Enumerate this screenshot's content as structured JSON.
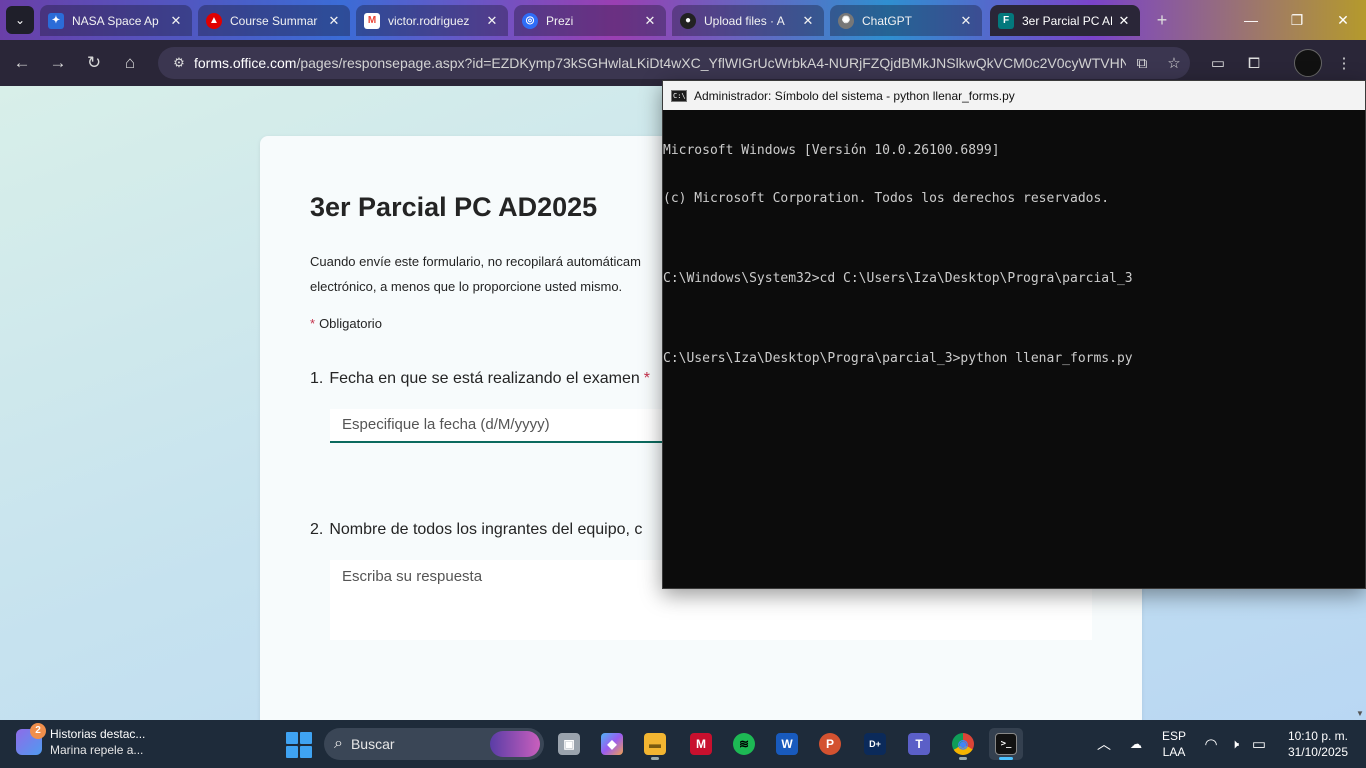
{
  "browser": {
    "tabs": [
      {
        "label": "NASA Space Ap",
        "favicon": "nasa-icon",
        "color": "#2b6cd8"
      },
      {
        "label": "Course Summar",
        "favicon": "redhat-icon",
        "color": "#e00000"
      },
      {
        "label": "victor.rodriguez",
        "favicon": "gmail-icon",
        "color": "#ea4335"
      },
      {
        "label": "Prezi",
        "favicon": "prezi-icon",
        "color": "#2f6df6"
      },
      {
        "label": "Upload files · A",
        "favicon": "github-icon",
        "color": "#222222"
      },
      {
        "label": "ChatGPT",
        "favicon": "chatgpt-icon",
        "color": "#777777"
      },
      {
        "label": "3er Parcial PC AD",
        "favicon": "forms-icon",
        "color": "#03787c",
        "active": true
      }
    ],
    "url_domain": "forms.office.com",
    "url_path": "/pages/responsepage.aspx?id=EZDKymp73kSGHwlaLKiDt4wXC_YflWIGrUcWrbkA4-NURjFZQjdBMkJNSlkwQkVCM0c2V0cyWTVHNS...",
    "icons": {
      "back": "←",
      "forward": "→",
      "reload": "↻",
      "home": "⌂",
      "site_info": "⚙",
      "install": "⧉",
      "bookmark": "☆",
      "split": "▭",
      "extensions": "⧠",
      "menu": "⋮",
      "minimize": "—",
      "maximize": "❐",
      "close": "✕",
      "tab_close": "✕",
      "new_tab": "+",
      "tab_menu": "⌄"
    }
  },
  "form": {
    "title": "3er Parcial PC AD2025",
    "description": "Cuando envíe este formulario, no recopilará automáticam electrónico, a menos que lo proporcione usted mismo.",
    "required_marker": "*",
    "required_label": "Obligatorio",
    "questions": [
      {
        "number": "1.",
        "text": "Fecha en que se está realizando el examen",
        "required_star": "*",
        "placeholder": "Especifique la fecha (d/M/yyyy)"
      },
      {
        "number": "2.",
        "text": "Nombre de todos los ingrantes del equipo, c",
        "placeholder": "Escriba su respuesta"
      }
    ]
  },
  "terminal": {
    "title": "Administrador: Símbolo del sistema - python  llenar_forms.py",
    "lines": [
      "Microsoft Windows [Versión 10.0.26100.6899]",
      "(c) Microsoft Corporation. Todos los derechos reservados.",
      "",
      "C:\\Windows\\System32>cd C:\\Users\\Iza\\Desktop\\Progra\\parcial_3",
      "",
      "C:\\Users\\Iza\\Desktop\\Progra\\parcial_3>python llenar_forms.py"
    ]
  },
  "taskbar": {
    "widget_badge": "2",
    "widget_title": "Historias destac...",
    "widget_sub": "Marina repele a...",
    "search_label": "Buscar",
    "apps": [
      {
        "name": "task-view-icon",
        "glyph": "▣",
        "color": "#9aa3ad"
      },
      {
        "name": "copilot-icon",
        "glyph": "◆",
        "color": "#7a5cf0"
      },
      {
        "name": "file-explorer-icon",
        "glyph": "▬",
        "color": "#f2b531"
      },
      {
        "name": "mcafee-icon",
        "glyph": "M",
        "color": "#c8102e"
      },
      {
        "name": "spotify-icon",
        "glyph": "≋",
        "color": "#1db954"
      },
      {
        "name": "word-icon",
        "glyph": "W",
        "color": "#185abd"
      },
      {
        "name": "powerpoint-icon",
        "glyph": "P",
        "color": "#d35230"
      },
      {
        "name": "disney-plus-icon",
        "glyph": "D+",
        "color": "#0b2a5a"
      },
      {
        "name": "teams-icon",
        "glyph": "T",
        "color": "#5b5fc7"
      },
      {
        "name": "chrome-icon",
        "glyph": "◉",
        "color": "#db4437"
      },
      {
        "name": "terminal-icon",
        "glyph": ">_",
        "color": "#111111",
        "active": true
      }
    ],
    "tray": {
      "chevron": "︿",
      "language_top": "ESP",
      "language_bottom": "LAA",
      "wifi": "◠",
      "volume": "🕨",
      "battery": "▭",
      "time": "10:10 p. m.",
      "date": "31/10/2025"
    }
  }
}
